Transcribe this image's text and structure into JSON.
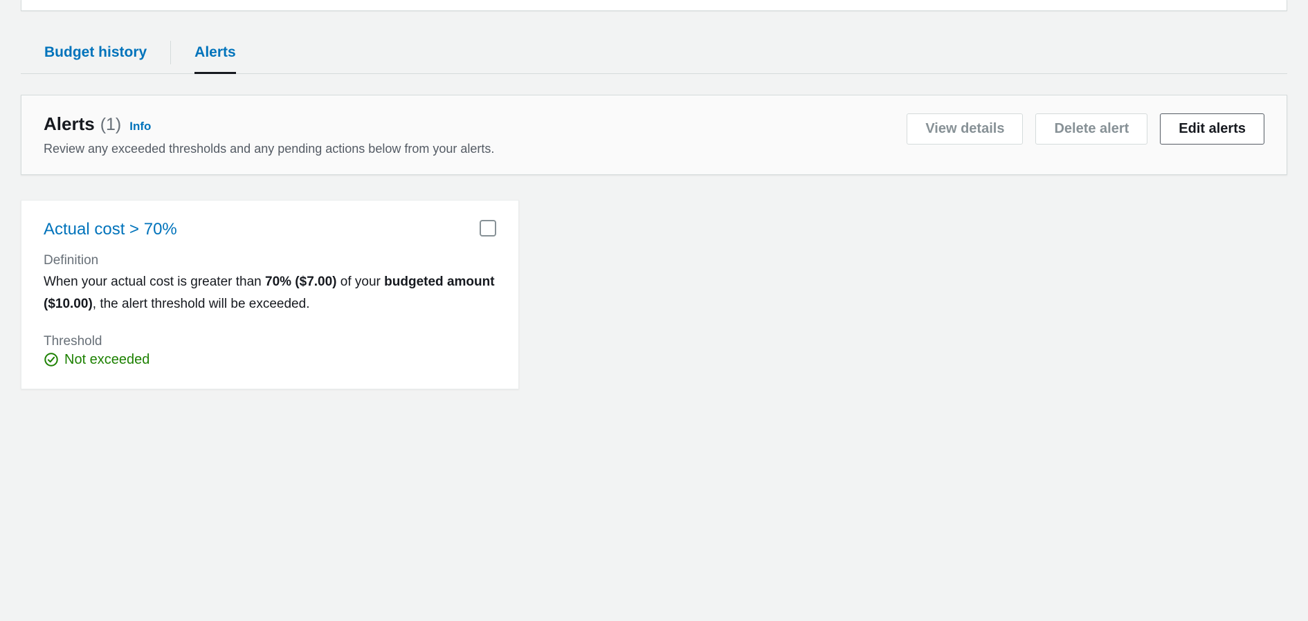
{
  "tabs": {
    "budget_history": "Budget history",
    "alerts": "Alerts"
  },
  "header": {
    "title": "Alerts",
    "count": "(1)",
    "info": "Info",
    "subtitle": "Review any exceeded thresholds and any pending actions below from your alerts."
  },
  "buttons": {
    "view_details": "View details",
    "delete_alert": "Delete alert",
    "edit_alerts": "Edit alerts"
  },
  "alert_card": {
    "title": "Actual cost > 70%",
    "definition_label": "Definition",
    "definition_pre": "When your actual cost is greater than ",
    "definition_bold1": "70% ($7.00)",
    "definition_mid": " of your ",
    "definition_bold2": "budgeted amount ($10.00)",
    "definition_post": ", the alert threshold will be exceeded.",
    "threshold_label": "Threshold",
    "status": "Not exceeded"
  }
}
